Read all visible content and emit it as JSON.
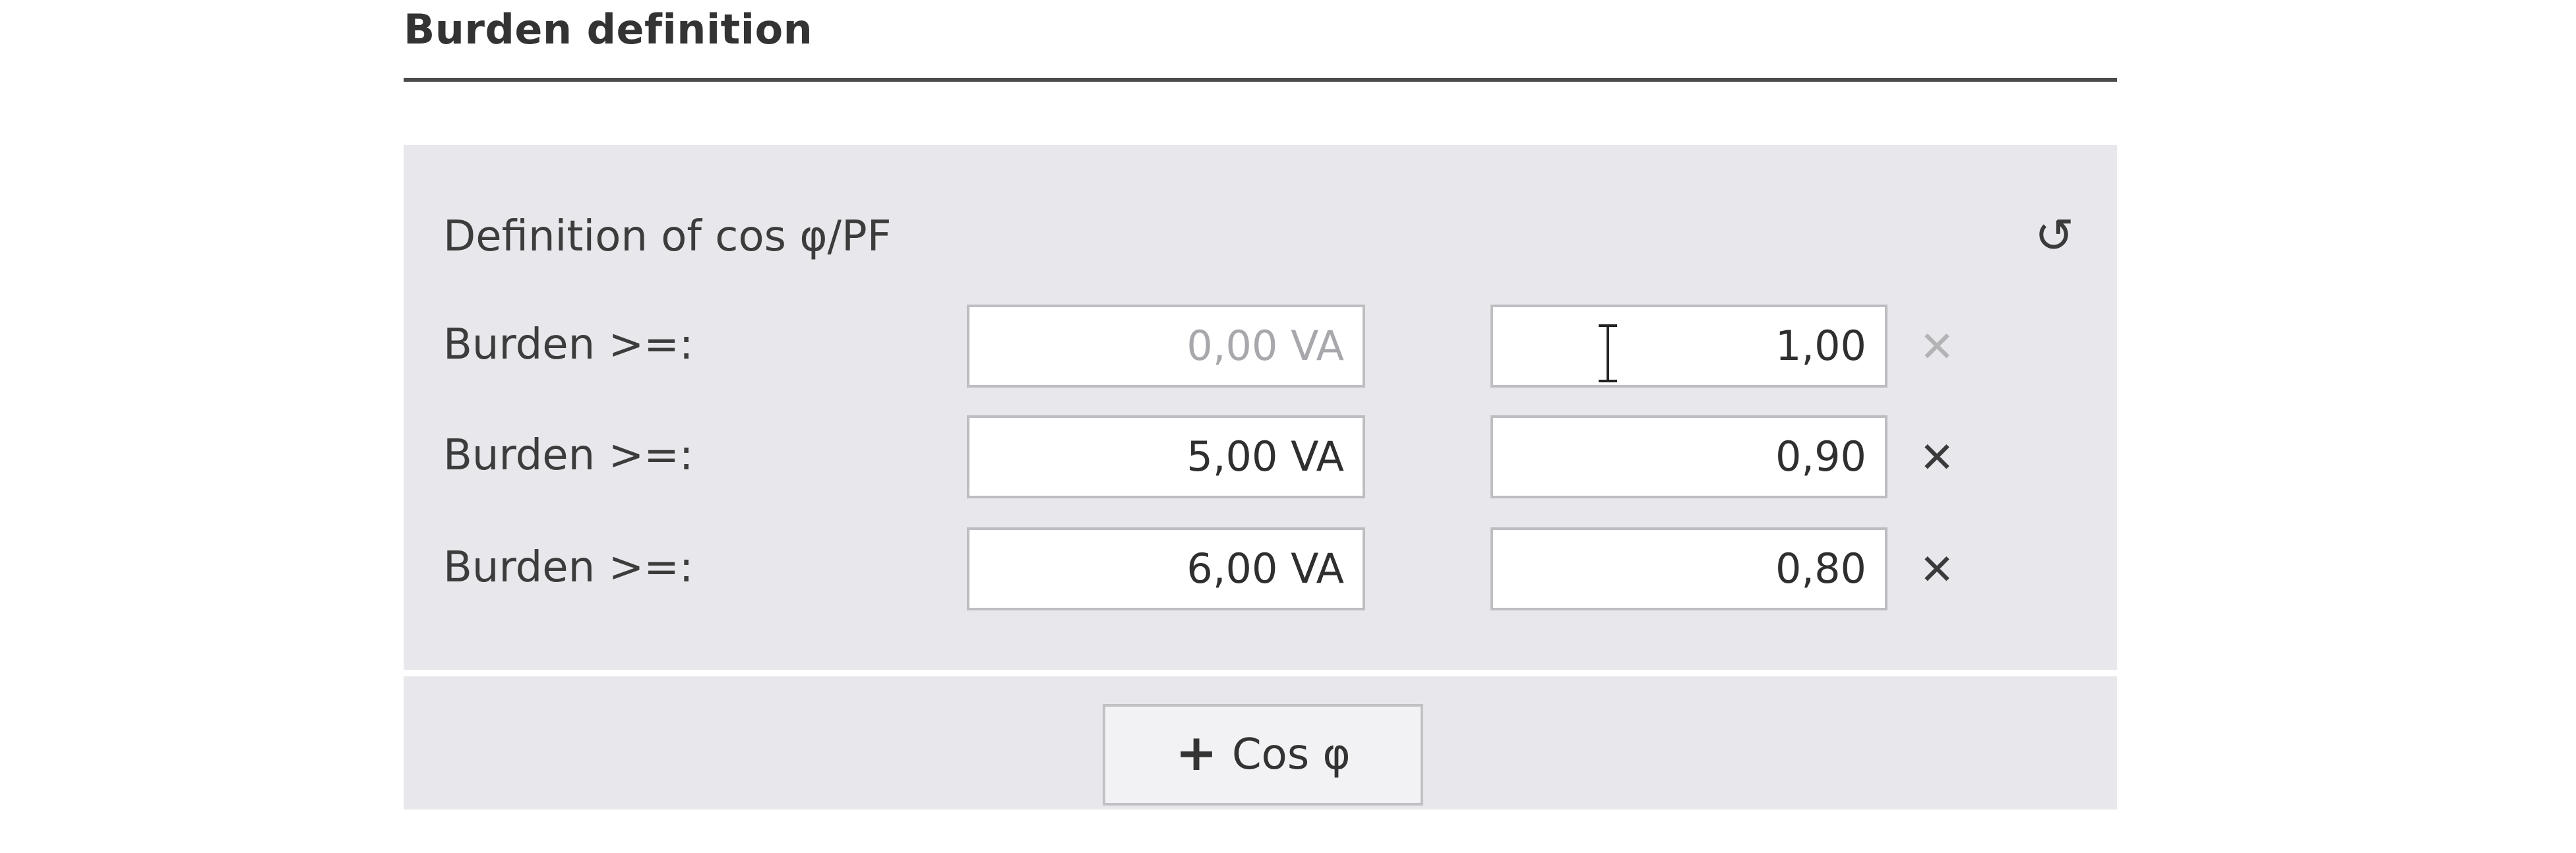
{
  "section": {
    "title": "Burden definition"
  },
  "panel": {
    "subheading": "Definition of cos φ/PF",
    "reset_icon": "↺",
    "rows": [
      {
        "label": "Burden >=:",
        "burden_value": "0,00 VA",
        "burden_disabled": true,
        "cos_value": "1,00",
        "remove_icon": "✕",
        "remove_disabled": true
      },
      {
        "label": "Burden >=:",
        "burden_value": "5,00 VA",
        "burden_disabled": false,
        "cos_value": "0,90",
        "remove_icon": "✕",
        "remove_disabled": false
      },
      {
        "label": "Burden >=:",
        "burden_value": "6,00 VA",
        "burden_disabled": false,
        "cos_value": "0,80",
        "remove_icon": "✕",
        "remove_disabled": false
      }
    ]
  },
  "footer": {
    "add_button_icon": "+",
    "add_button_label": "Cos φ"
  },
  "icons": {
    "reset": "reset-icon",
    "remove": "close-icon",
    "add": "plus-icon"
  },
  "colors": {
    "panel_background": "#e8e8ec",
    "field_border": "#bdbdc2",
    "disabled_text": "#a8a8ac"
  }
}
